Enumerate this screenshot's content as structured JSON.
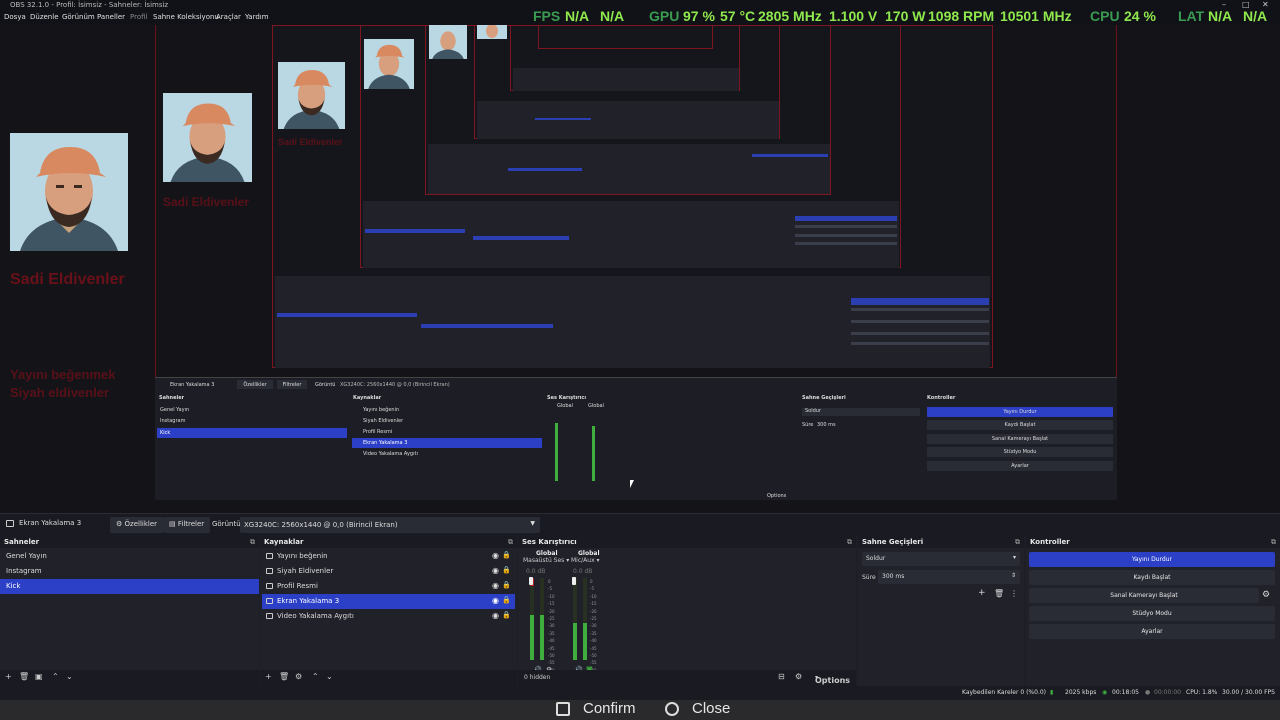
{
  "window": {
    "title": "OBS 32.1.0 - Profil: İsimsiz - Sahneler: İsimsiz",
    "minimize": "–",
    "maximize": "□",
    "close": "✕"
  },
  "menu": [
    "Dosya",
    "Düzenle",
    "Görünüm",
    "Paneller",
    "Profil",
    "Sahne Koleksiyonu",
    "Araçlar",
    "Yardım"
  ],
  "overlay": {
    "fps_label": "FPS",
    "fps_v1": "N/A",
    "fps_v2": "N/A",
    "gpu_label": "GPU",
    "gpu_load": "97 %",
    "gpu_temp": "57 °C",
    "gpu_clock": "2805 MHz",
    "gpu_volt": "1.100 V",
    "gpu_power": "170 W",
    "gpu_fan": "1098 RPM",
    "gpu_mem": "10501 MHz",
    "cpu_label": "CPU",
    "cpu_load": "24 %",
    "lat_label": "LAT",
    "lat_v1": "N/A",
    "lat_v2": "N/A"
  },
  "preview": {
    "red_name": "Sadi Eldivenler",
    "red_line2": "Yayını beğenmek",
    "red_line3": "Siyah eldivenler"
  },
  "nested": {
    "context_source": "Ekran Yakalama 3",
    "props": "Özellikler",
    "filters": "Filtreler",
    "display_label": "Görüntü",
    "display_value": "XG3240C: 2560x1440 @ 0,0 (Birincil Ekran)",
    "scenes_title": "Sahneler",
    "sources_title": "Kaynaklar",
    "mixer_title": "Ses Karıştırıcı",
    "transitions_title": "Sahne Geçişleri",
    "controls_title": "Kontroller",
    "scenes": [
      "Genel Yayın",
      "Instagram",
      "Kick"
    ],
    "sources": [
      "Yayını beğenin",
      "Siyah Eldivenler",
      "Profil Resmi",
      "Ekran Yakalama 3",
      "Video Yakalama Aygıtı"
    ],
    "transition": "Soldur",
    "duration_label": "Süre",
    "duration": "300 ms",
    "controls": [
      "Yayını Durdur",
      "Kaydı Başlat",
      "Sanal Kamerayı Başlat",
      "Stüdyo Modu",
      "Ayarlar"
    ],
    "options": "Options",
    "hidden": "0 hidden",
    "ch_global": "Global",
    "dev1": "Masaüstü Ses",
    "dev2": "Mic/Aux",
    "db": "0.0 dB"
  },
  "context_bar": {
    "source_name": "Ekran Yakalama 3",
    "properties": "Özellikler",
    "filters": "Filtreler",
    "display_label": "Görüntü",
    "display_value": "XG3240C: 2560x1440 @ 0,0 (Birincil Ekran)"
  },
  "scenes": {
    "title": "Sahneler",
    "items": [
      {
        "label": "Genel Yayın",
        "selected": false
      },
      {
        "label": "Instagram",
        "selected": false
      },
      {
        "label": "Kick",
        "selected": true
      }
    ]
  },
  "sources": {
    "title": "Kaynaklar",
    "items": [
      {
        "label": "Yayını beğenin",
        "selected": false
      },
      {
        "label": "Siyah Eldivenler",
        "selected": false
      },
      {
        "label": "Profil Resmi",
        "selected": false
      },
      {
        "label": "Ekran Yakalama 3",
        "selected": true
      },
      {
        "label": "Video Yakalama Aygıtı",
        "selected": false
      }
    ]
  },
  "mixer": {
    "title": "Ses Karıştırıcı",
    "channels": [
      {
        "scope": "Global",
        "device": "Masaüstü Ses",
        "db": "0.0 dB",
        "level": 0.55
      },
      {
        "scope": "Global",
        "device": "Mic/Aux",
        "db": "0.0 dB",
        "level": 0.45
      }
    ],
    "scale": [
      "0",
      "-5",
      "-10",
      "-15",
      "-20",
      "-25",
      "-30",
      "-35",
      "-40",
      "-45",
      "-50",
      "-55",
      "-60"
    ],
    "hidden": "0 hidden",
    "options": "Options"
  },
  "transitions": {
    "title": "Sahne Geçişleri",
    "selected": "Soldur",
    "duration_label": "Süre",
    "duration": "300 ms"
  },
  "controls": {
    "title": "Kontroller",
    "buttons": [
      "Yayını Durdur",
      "Kaydı Başlat",
      "Sanal Kamerayı Başlat",
      "Stüdyo Modu",
      "Ayarlar"
    ]
  },
  "status": {
    "dropped": "Kaybedilen Kareler 0 (%0.0)",
    "bitrate": "2025 kbps",
    "stream_time": "00:18:05",
    "rec_time": "00:00:00",
    "cpu": "CPU: 1.8%",
    "fps": "30.00 / 30.00 FPS"
  },
  "prompt": {
    "confirm": "Confirm",
    "close": "Close"
  },
  "colors": {
    "accent": "#2b3fc7",
    "background": "#1e1f26",
    "meter_green": "#3fae3f",
    "overlay_green": "#8fe84d"
  }
}
